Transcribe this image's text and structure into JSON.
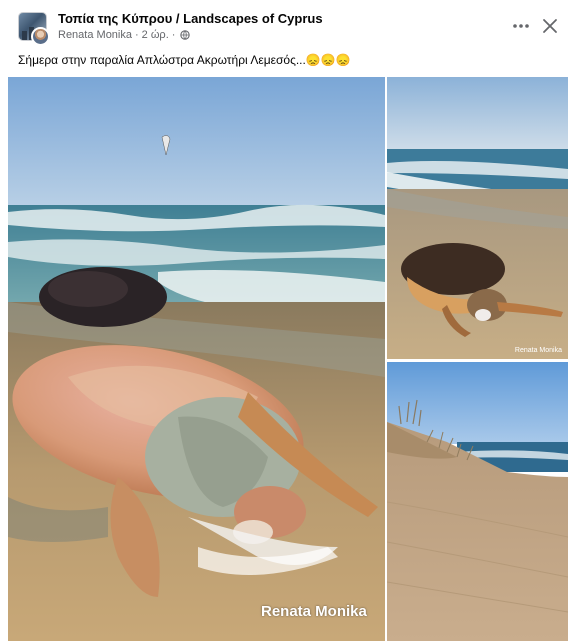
{
  "post": {
    "group_name": "Τοπία της Κύπρου / Landscapes of Cyprus",
    "author": "Renata Monika",
    "dot": "·",
    "time": "2 ώρ.",
    "text": "Σήμερα στην παραλία Απλώστρα  Ακρωτήρι Λεμεσός...😞😞😞"
  },
  "photos": {
    "main_watermark": "Renata Monika",
    "top_right_watermark": "Renata Monika"
  },
  "icons": {
    "more": "more-horizontal-icon",
    "close": "close-icon",
    "privacy": "globe-icon"
  },
  "colors": {
    "secondary_text": "#65676b",
    "primary_text": "#050505"
  }
}
